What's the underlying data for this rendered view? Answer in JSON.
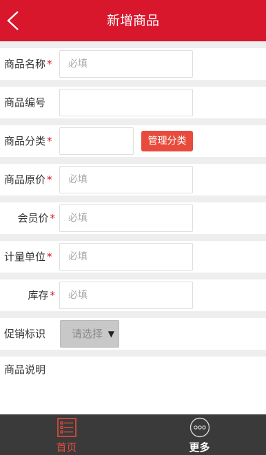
{
  "header": {
    "title": "新增商品"
  },
  "form": {
    "name": {
      "label": "商品名称",
      "required": "*",
      "placeholder": "必填"
    },
    "code": {
      "label": "商品编号",
      "placeholder": ""
    },
    "category": {
      "label": "商品分类",
      "required": "*",
      "manage_button": "管理分类"
    },
    "original_price": {
      "label": "商品原价",
      "required": "*",
      "placeholder": "必填"
    },
    "member_price": {
      "label": "会员价",
      "required": "*",
      "placeholder": "必填"
    },
    "unit": {
      "label": "计量单位",
      "required": "*",
      "placeholder": "必填"
    },
    "stock": {
      "label": "库存",
      "required": "*",
      "placeholder": "必填"
    },
    "promotion": {
      "label": "促销标识",
      "selected": "请选择",
      "arrow": "▼"
    },
    "description": {
      "label": "商品说明"
    }
  },
  "tabbar": {
    "home": {
      "label": "首页",
      "icon": "list-icon",
      "active_color": "#e84b3c"
    },
    "more": {
      "label": "更多",
      "icon": "more-dots-icon"
    }
  },
  "colors": {
    "accent": "#d8162c",
    "button": "#e84b3c",
    "tabbar": "#3a3a3a"
  }
}
